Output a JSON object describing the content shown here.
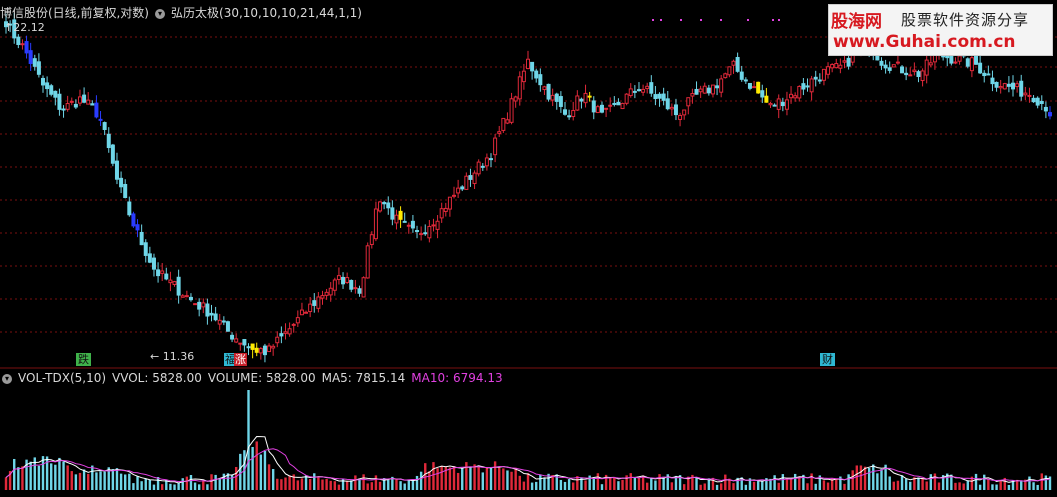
{
  "header": {
    "stock_title": "博信股份(日线,前复权,对数)",
    "indicator_name": "弘历太极",
    "indicator_params": "(30,10,10,10,21,44,1,1)"
  },
  "volume_header": {
    "indicator": "VOL-TDX(5,10)",
    "vvol": "VVOL: 5828.00",
    "volume": "VOLUME: 5828.00",
    "ma5": "MA5: 7815.14",
    "ma10": "MA10: 6794.13"
  },
  "colors": {
    "background": "#000000",
    "up": "#e0293a",
    "down": "#6fd6e8",
    "blue": "#2a3cff",
    "yellow": "#ffea00",
    "grid": "#7a1010",
    "ma5": "#ffffff",
    "ma10": "#e040e0",
    "header_text": "#d8d8d8",
    "magenta_text": "#e040e0"
  },
  "watermark": {
    "brand_cn": "股海网",
    "slogan": "股票软件资源分享",
    "url": "www.Guhai.com.cn"
  },
  "annotations": {
    "high_label": "22.12",
    "low_label": "11.36",
    "signal_die": "跌",
    "signal_zhang": "涨",
    "signal_cai": "财",
    "signal_fu": "福"
  },
  "chart_data": {
    "type": "candlestick",
    "title": "博信股份(日线,前复权,对数)",
    "scale": "log",
    "price_high": 22.12,
    "price_low": 11.36,
    "close_sequence_approx": [
      22.12,
      21.0,
      19.5,
      18.6,
      19.0,
      18.4,
      16.0,
      14.5,
      13.4,
      13.0,
      12.6,
      12.3,
      11.8,
      11.5,
      11.36,
      11.8,
      12.3,
      12.8,
      13.2,
      12.9,
      15.6,
      14.8,
      14.4,
      14.9,
      15.6,
      16.3,
      17.0,
      18.6,
      20.5,
      19.3,
      18.4,
      19.2,
      18.3,
      18.9,
      19.5,
      19.0,
      18.4,
      19.1,
      19.5,
      20.3,
      19.5,
      18.7,
      19.1,
      19.6,
      20.1,
      20.3,
      21.6,
      20.5,
      20.2,
      20.0,
      20.8,
      20.6,
      20.4,
      19.7,
      19.4,
      19.2,
      18.6
    ],
    "volume_last": 5828.0,
    "vol_ma5": 7815.14,
    "vol_ma10": 6794.13,
    "grid": true
  }
}
